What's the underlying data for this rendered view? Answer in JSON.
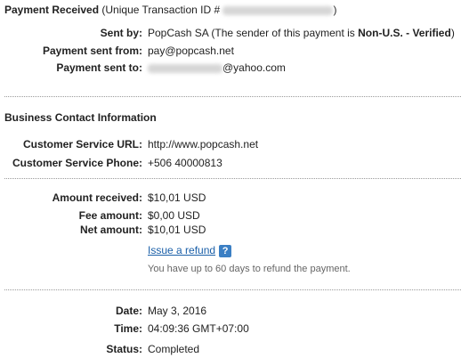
{
  "header": {
    "title": "Payment Received",
    "txn_prefix": " (Unique Transaction ID #",
    "txn_suffix": ")"
  },
  "sender": {
    "sent_by_label": "Sent by:",
    "sent_by_name": "PopCash SA",
    "sent_by_note_prefix": " (The sender of this payment is ",
    "sent_by_status": "Non-U.S. - Verified",
    "sent_by_note_suffix": ")",
    "from_label": "Payment sent from:",
    "from_value": "pay@popcash.net",
    "to_label": "Payment sent to:",
    "to_domain": "@yahoo.com"
  },
  "business": {
    "heading": "Business Contact Information",
    "url_label": "Customer Service URL:",
    "url_value": "http://www.popcash.net",
    "phone_label": "Customer Service Phone:",
    "phone_value": "+506 40000813"
  },
  "amounts": {
    "received_label": "Amount received:",
    "received_value": "$10,01 USD",
    "fee_label": "Fee amount:",
    "fee_value": "$0,00 USD",
    "net_label": "Net amount:",
    "net_value": "$10,01 USD",
    "refund_link": "Issue a refund",
    "help_icon": "?",
    "refund_note": "You have up to 60 days to refund the payment."
  },
  "status": {
    "date_label": "Date:",
    "date_value": "May 3, 2016",
    "time_label": "Time:",
    "time_value": "04:09:36 GMT+07:00",
    "status_label": "Status:",
    "status_value": "Completed"
  }
}
